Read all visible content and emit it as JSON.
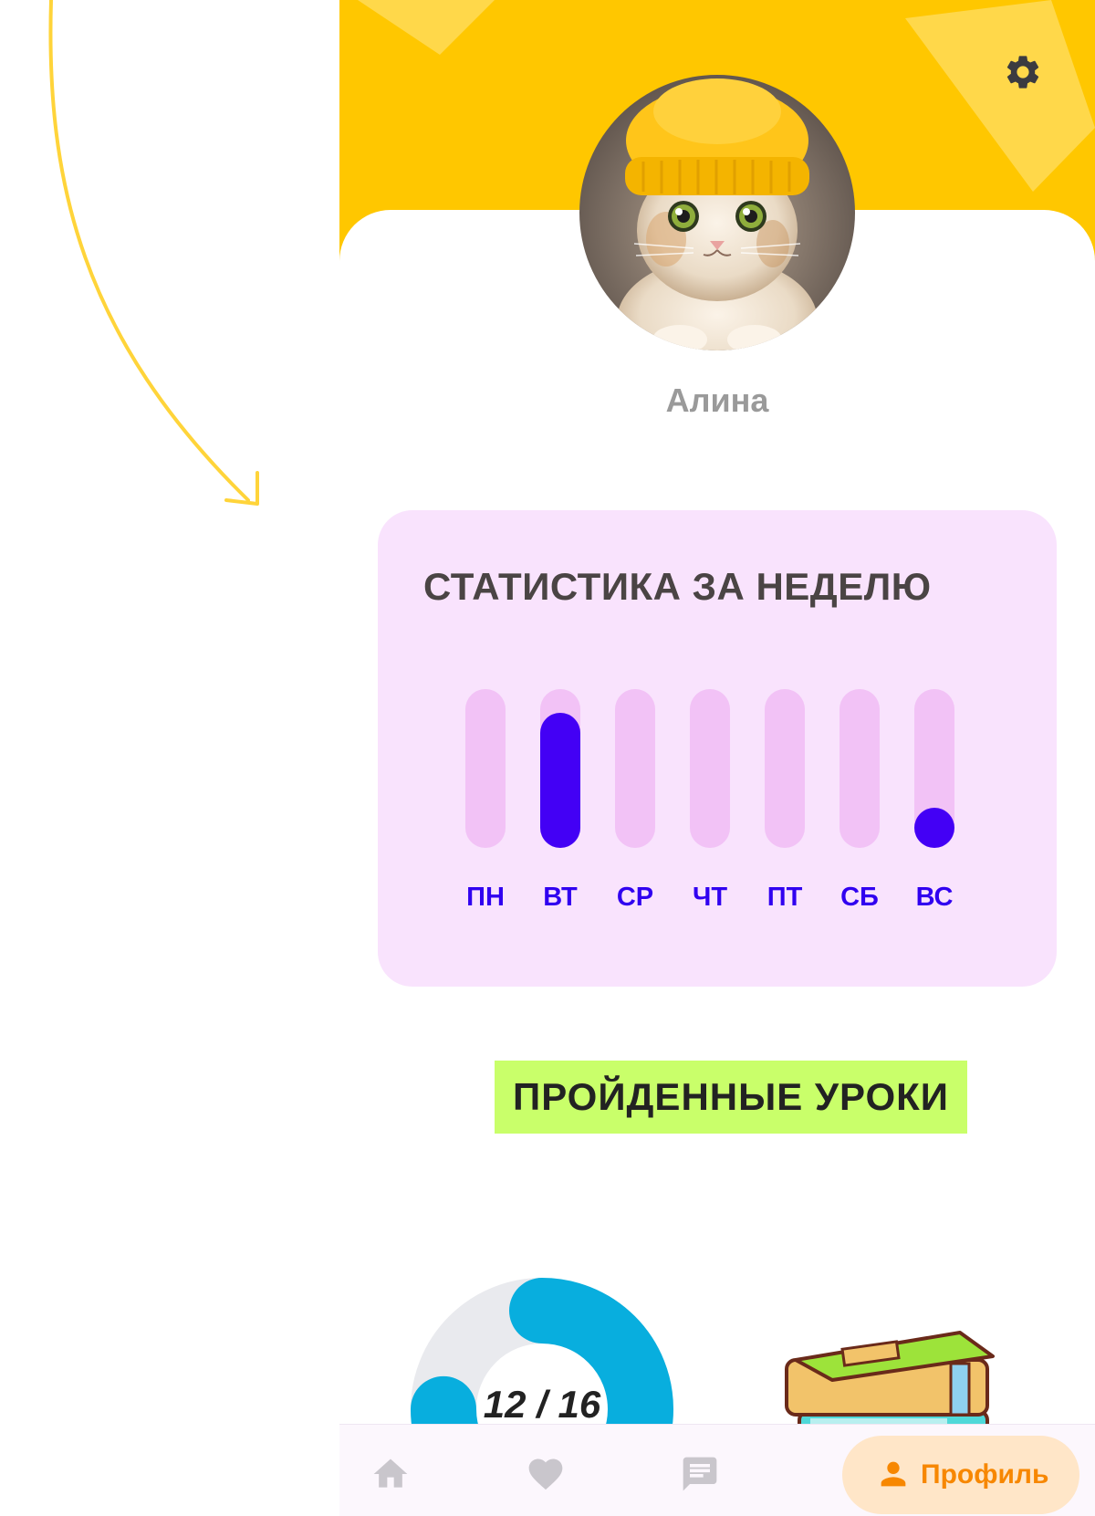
{
  "header": {
    "background_color": "#FFC700",
    "settings_icon": "gear-icon"
  },
  "profile": {
    "name": "Алина",
    "avatar": "kitten-in-yellow-hat"
  },
  "weekly_stats": {
    "title": "СТАТИСТИКА ЗА НЕДЕЛЮ",
    "track_color": "#F2C2F6",
    "fill_color": "#4300F5",
    "days": [
      {
        "label": "ПН",
        "level": 0
      },
      {
        "label": "ВТ",
        "level": 0.85
      },
      {
        "label": "СР",
        "level": 0
      },
      {
        "label": "ЧТ",
        "level": 0
      },
      {
        "label": "ПТ",
        "level": 0
      },
      {
        "label": "СБ",
        "level": 0
      },
      {
        "label": "ВС",
        "level": 0.25
      }
    ]
  },
  "lessons": {
    "heading": "ПРОЙДЕННЫЕ УРОКИ",
    "completed": 12,
    "total": 16,
    "progress_label": "12 / 16",
    "books_image": "stack-of-books-icon"
  },
  "bottom_nav": {
    "items": [
      {
        "icon": "home-icon"
      },
      {
        "icon": "heart-icon"
      },
      {
        "icon": "chat-icon"
      },
      {
        "icon": "person-icon",
        "label": "Профиль",
        "active": true
      }
    ],
    "active_color": "#F78700"
  }
}
